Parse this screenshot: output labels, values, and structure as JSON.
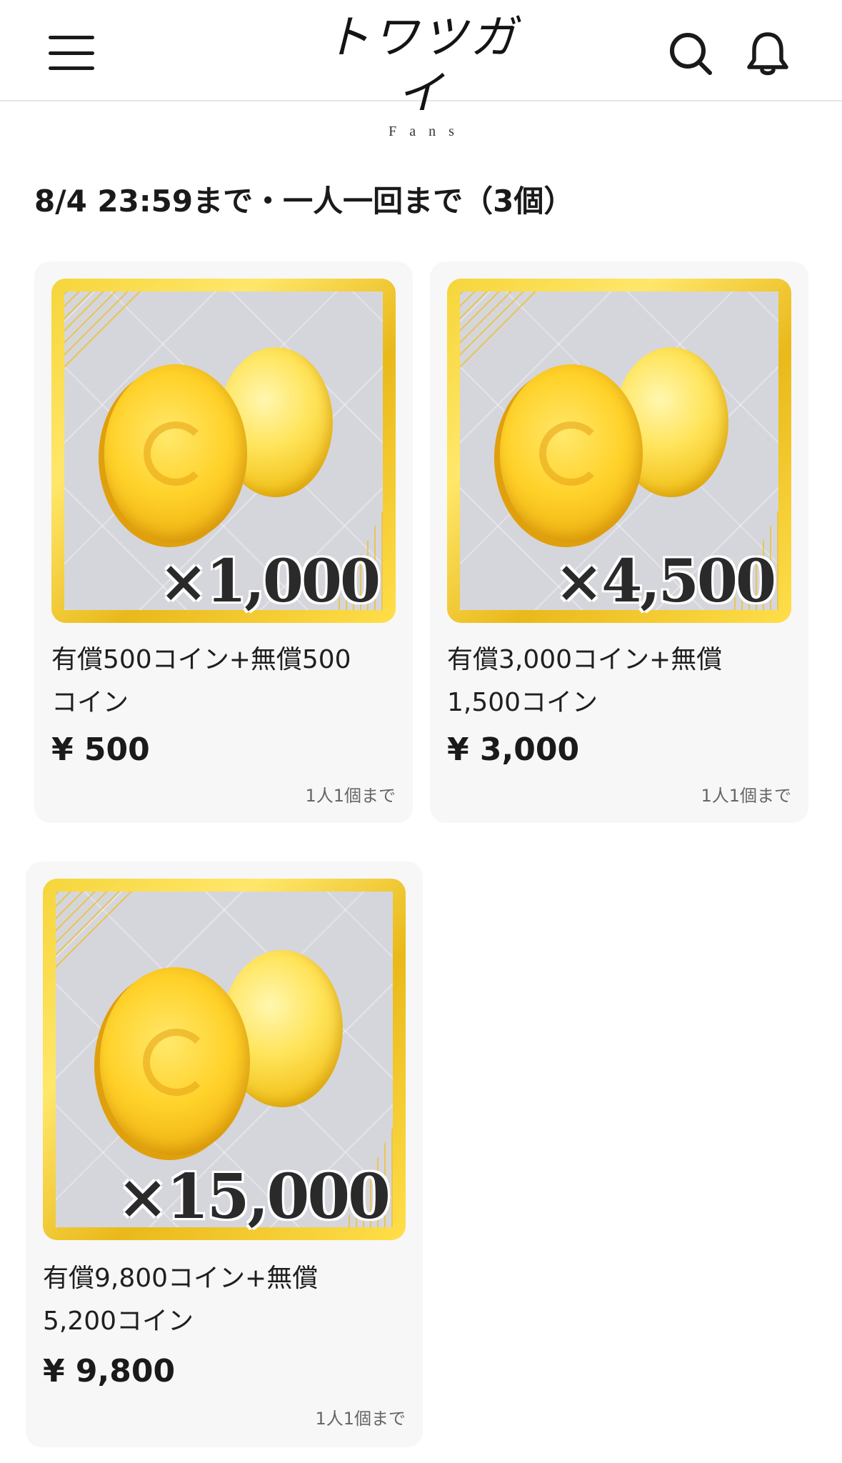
{
  "header": {
    "logo_main": "トワツガイ",
    "logo_sub": "Fans",
    "menu_icon": "hamburger-menu-icon",
    "search_icon": "search-icon",
    "bell_icon": "bell-icon"
  },
  "section": {
    "title": "8/4 23:59まで・一人一回まで（3個）"
  },
  "products": [
    {
      "quantity_label": "×1,000",
      "description_line1": "有償500コイン+無償500",
      "description_line2": "コイン",
      "price": "¥ 500",
      "limit": "1人1個まで"
    },
    {
      "quantity_label": "×4,500",
      "description_line1": "有償3,000コイン+無償",
      "description_line2": "1,500コイン",
      "price": "¥ 3,000",
      "limit": "1人1個まで"
    },
    {
      "quantity_label": "×15,000",
      "description_line1": "有償9,800コイン+無償",
      "description_line2": "5,200コイン",
      "price": "¥ 9,800",
      "limit": "1人1個まで"
    }
  ],
  "colors": {
    "frame_gold": "#f6d53a",
    "coin_gold": "#ffd22a",
    "card_bg": "#f7f7f7",
    "text": "#1a1a1a"
  }
}
